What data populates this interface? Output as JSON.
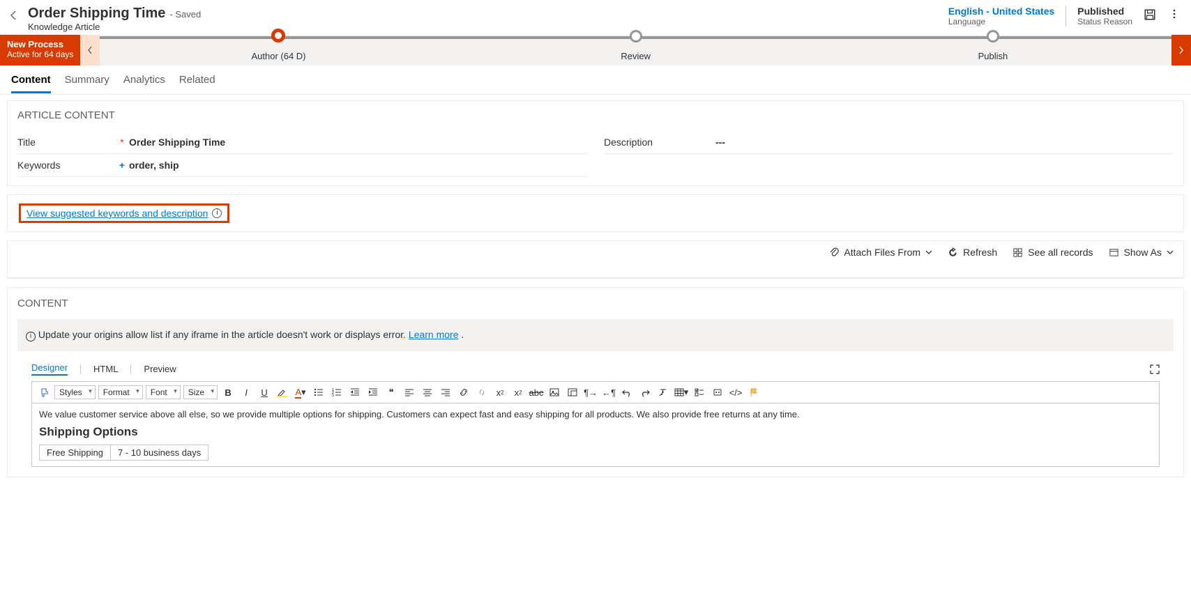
{
  "header": {
    "title": "Order Shipping Time",
    "saved": "- Saved",
    "subtitle": "Knowledge Article",
    "lang_value": "English - United States",
    "lang_label": "Language",
    "status_value": "Published",
    "status_label": "Status Reason"
  },
  "process": {
    "name": "New Process",
    "active_for": "Active for 64 days",
    "stages": [
      "Author  (64 D)",
      "Review",
      "Publish"
    ]
  },
  "tabs": [
    "Content",
    "Summary",
    "Analytics",
    "Related"
  ],
  "article": {
    "section_title": "ARTICLE CONTENT",
    "title_label": "Title",
    "title_value": "Order Shipping Time",
    "keywords_label": "Keywords",
    "keywords_value": "order, ship",
    "description_label": "Description",
    "description_value": "---"
  },
  "suggest_link": "View suggested keywords and description",
  "attach": {
    "attach_label": "Attach Files From",
    "refresh_label": "Refresh",
    "see_all_label": "See all records",
    "show_as_label": "Show As"
  },
  "content_section_title": "CONTENT",
  "banner_text": "Update your origins allow list if any iframe in the article doesn't work or displays error.  ",
  "banner_link": "Learn more",
  "editor_tabs": [
    "Designer",
    "HTML",
    "Preview"
  ],
  "toolbar_selects": [
    "Styles",
    "Format",
    "Font",
    "Size"
  ],
  "editor_body": {
    "intro": "We value customer service above all else, so we provide multiple options for shipping. Customers can expect fast and easy shipping for all products. We also provide free returns at any time.",
    "heading": "Shipping Options",
    "row1_label": "Free Shipping",
    "row1_value": "7 - 10 business days"
  }
}
